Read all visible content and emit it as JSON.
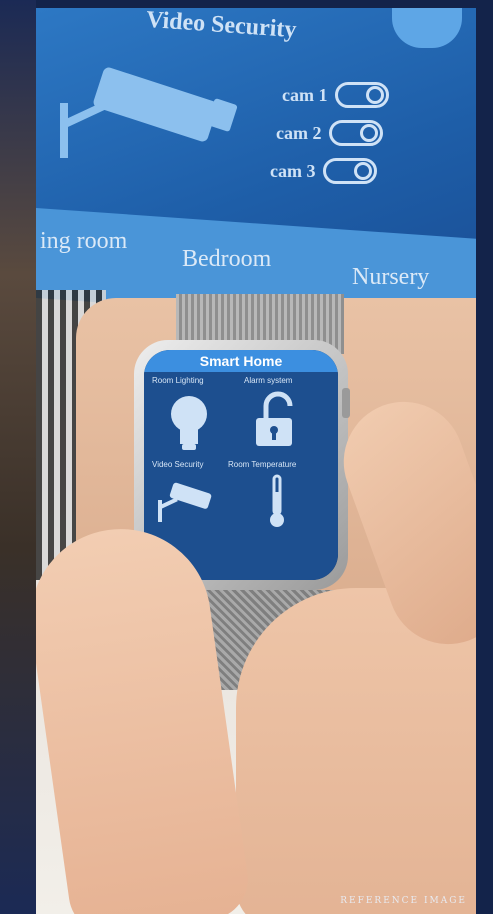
{
  "tablet": {
    "title": "Video Security",
    "cams": [
      "cam 1",
      "cam 2",
      "cam 3"
    ],
    "rooms": [
      "ing room",
      "Bedroom",
      "Nursery"
    ]
  },
  "watch": {
    "title": "Smart Home",
    "tiles": [
      {
        "label": "Room Lighting",
        "icon": "lightbulb-icon"
      },
      {
        "label": "Alarm system",
        "icon": "unlocked-padlock-icon"
      },
      {
        "label": "Video Security",
        "icon": "security-camera-icon"
      },
      {
        "label": "Room Temperature",
        "icon": "thermometer-icon"
      }
    ]
  },
  "watermark": "REFERENCE IMAGE",
  "colors": {
    "tablet_blue": "#2a6fb8",
    "watch_header": "#3c8fe0",
    "border": "#13234a"
  }
}
